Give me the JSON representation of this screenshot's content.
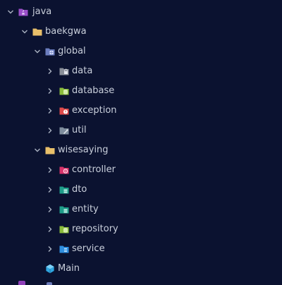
{
  "tree": {
    "items": [
      {
        "label": "java",
        "icon": "java-source-folder-icon"
      },
      {
        "label": "baekgwa",
        "icon": "package-folder-icon"
      },
      {
        "label": "global",
        "icon": "global-folder-icon"
      },
      {
        "label": "data",
        "icon": "data-folder-icon"
      },
      {
        "label": "database",
        "icon": "database-folder-icon"
      },
      {
        "label": "exception",
        "icon": "exception-folder-icon"
      },
      {
        "label": "util",
        "icon": "util-folder-icon"
      },
      {
        "label": "wisesaying",
        "icon": "package-folder-icon"
      },
      {
        "label": "controller",
        "icon": "controller-folder-icon"
      },
      {
        "label": "dto",
        "icon": "dto-folder-icon"
      },
      {
        "label": "entity",
        "icon": "entity-folder-icon"
      },
      {
        "label": "repository",
        "icon": "repository-folder-icon"
      },
      {
        "label": "service",
        "icon": "service-folder-icon"
      },
      {
        "label": "Main",
        "icon": "java-class-icon"
      }
    ]
  },
  "colors": {
    "background": "#0b1230",
    "text": "#c9cfdb",
    "chevron": "#aab2c2",
    "java_folder": "#9b4fc9",
    "package_folder": "#e8bf6a",
    "global_folder": "#6c7ec0",
    "data_folder": "#8a8f99",
    "database_folder": "#8bbd3c",
    "exception_folder": "#e04b4b",
    "util_folder": "#7f8e9e",
    "controller_folder": "#d8336a",
    "dto_folder": "#1f9e8a",
    "entity_folder": "#1f9e8a",
    "repository_folder": "#8bbd3c",
    "service_folder": "#2f8fe0",
    "main_class": "#2fa6e0"
  }
}
